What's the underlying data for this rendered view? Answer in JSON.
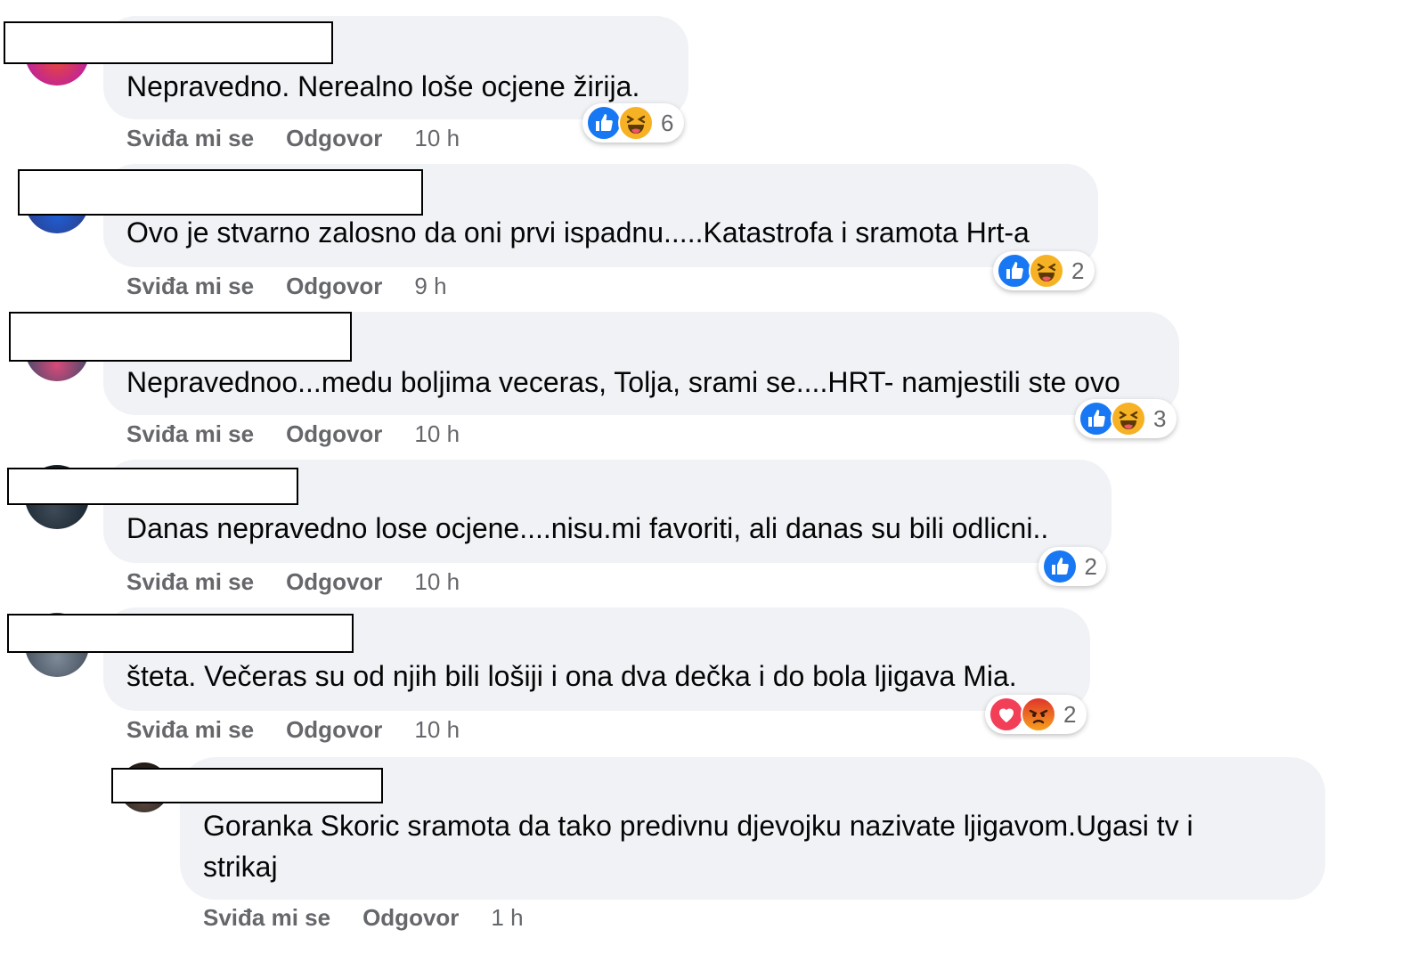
{
  "comments": [
    {
      "text": "Nepravedno. Nerealno loše ocjene žirija.",
      "like_label": "Sviđa mi se",
      "reply_label": "Odgovor",
      "time": "10 h",
      "reactions": [
        "like-icon",
        "haha-icon"
      ],
      "reaction_count": "6"
    },
    {
      "text": "Ovo je stvarno zalosno da oni prvi ispadnu.....Katastrofa i sramota Hrt-a",
      "like_label": "Sviđa mi se",
      "reply_label": "Odgovor",
      "time": "9 h",
      "reactions": [
        "like-icon",
        "haha-icon"
      ],
      "reaction_count": "2"
    },
    {
      "text": "Nepravednoo...medu boljima veceras, Tolja, srami se....HRT- namjestili ste ovo",
      "like_label": "Sviđa mi se",
      "reply_label": "Odgovor",
      "time": "10 h",
      "reactions": [
        "like-icon",
        "haha-icon"
      ],
      "reaction_count": "3"
    },
    {
      "text": "Danas nepravedno lose ocjene....nisu.mi favoriti, ali danas su bili odlicni..",
      "like_label": "Sviđa mi se",
      "reply_label": "Odgovor",
      "time": "10 h",
      "reactions": [
        "like-icon"
      ],
      "reaction_count": "2"
    },
    {
      "text": "šteta. Večeras su od njih bili lošiji i ona dva dečka i do bola ljigava Mia.",
      "like_label": "Sviđa mi se",
      "reply_label": "Odgovor",
      "time": "10 h",
      "reactions": [
        "love-icon",
        "angry-icon"
      ],
      "reaction_count": "2"
    }
  ],
  "reply": {
    "text_line1": "Goranka Skoric sramota da tako predivnu djevojku nazivate ljigavom.Ugasi tv i",
    "text_line2": "strikaj",
    "like_label": "Sviđa mi se",
    "reply_label": "Odgovor",
    "time": "1 h"
  },
  "colors": {
    "bubble": "#f0f2f5",
    "like_blue": "#1877f2",
    "haha_yellow": "#f7b125",
    "love_red": "#f33e58",
    "angry_orange": "#e9710f",
    "meta_grey": "#65676b"
  }
}
